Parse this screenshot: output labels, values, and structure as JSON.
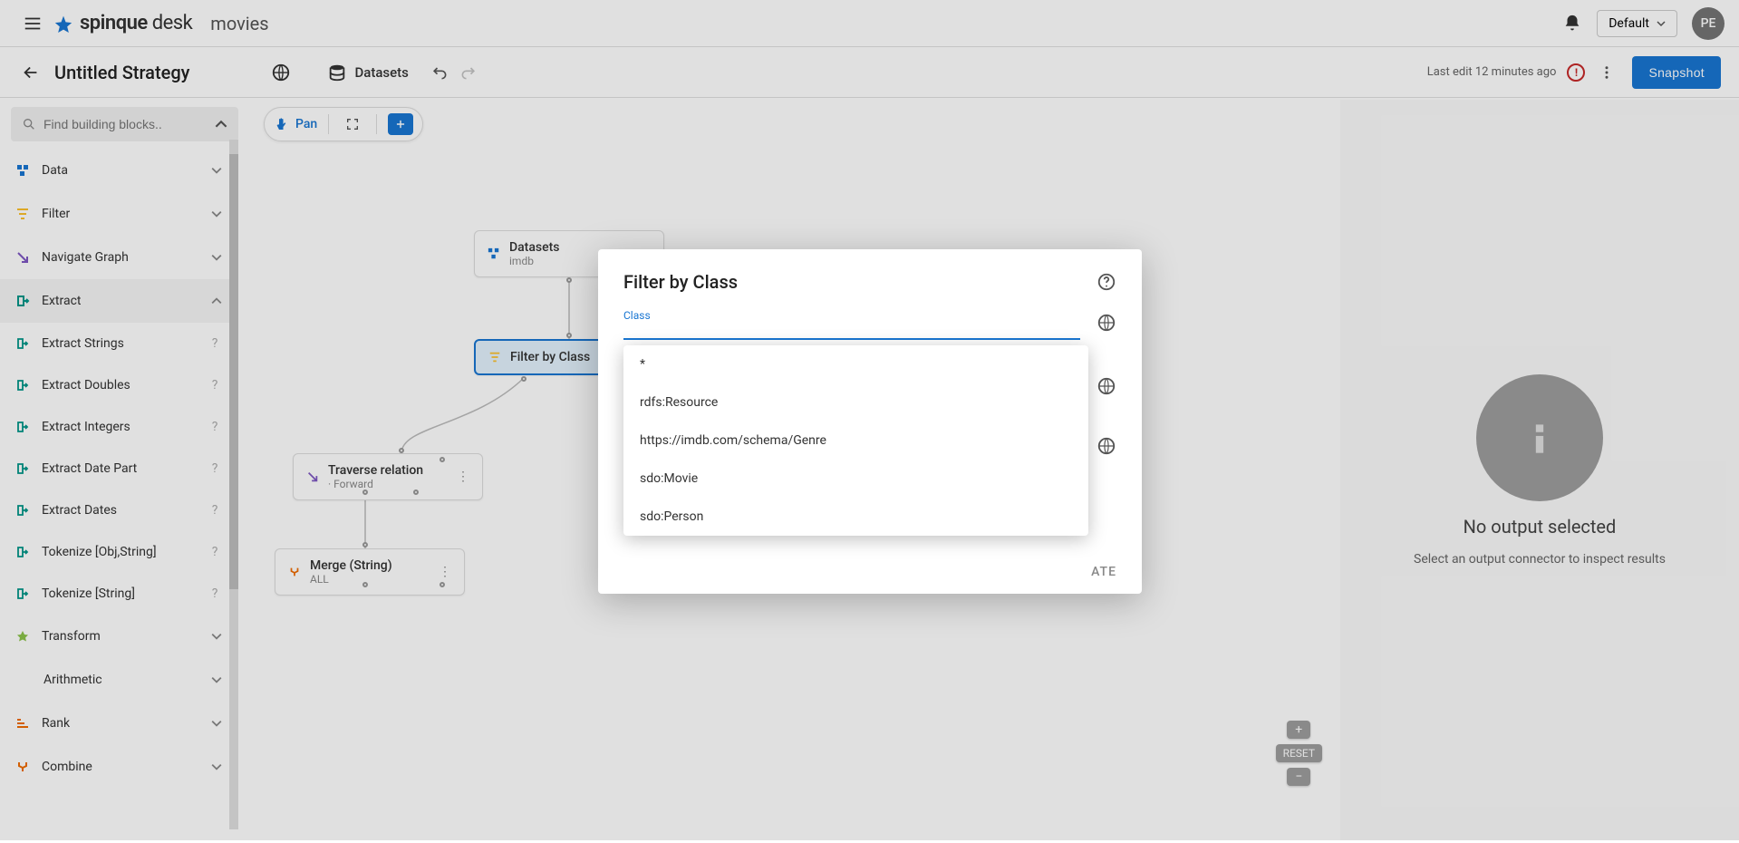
{
  "app": {
    "brand_primary": "spinque",
    "brand_secondary": "desk",
    "context": "movies"
  },
  "topbar": {
    "default_label": "Default",
    "avatar_initials": "PE"
  },
  "subbar": {
    "title": "Untitled Strategy",
    "datasets_label": "Datasets",
    "last_edit": "Last edit 12 minutes ago",
    "snapshot_label": "Snapshot"
  },
  "sidebar": {
    "search_placeholder": "Find building blocks..",
    "pan_label": "Pan",
    "categories": [
      {
        "label": "Data",
        "icon": "data",
        "expanded": false
      },
      {
        "label": "Filter",
        "icon": "filter",
        "expanded": false
      },
      {
        "label": "Navigate Graph",
        "icon": "navigate",
        "expanded": false
      },
      {
        "label": "Extract",
        "icon": "extract",
        "expanded": true,
        "items": [
          {
            "label": "Extract Strings"
          },
          {
            "label": "Extract Doubles"
          },
          {
            "label": "Extract Integers"
          },
          {
            "label": "Extract Date Part"
          },
          {
            "label": "Extract Dates"
          },
          {
            "label": "Tokenize [Obj,String]"
          },
          {
            "label": "Tokenize [String]"
          }
        ]
      },
      {
        "label": "Transform",
        "icon": "transform",
        "expanded": false
      },
      {
        "label": "Arithmetic",
        "icon": "none",
        "expanded": false,
        "indent": true
      },
      {
        "label": "Rank",
        "icon": "rank",
        "expanded": false
      },
      {
        "label": "Combine",
        "icon": "combine",
        "expanded": false
      }
    ]
  },
  "canvas": {
    "nodes": {
      "datasets": {
        "title": "Datasets",
        "sub": "imdb"
      },
      "filter_class": {
        "title": "Filter by Class"
      },
      "traverse": {
        "title": "Traverse relation",
        "sub": "· Forward"
      },
      "merge": {
        "title": "Merge (String)",
        "sub": "ALL"
      }
    },
    "reset_label": "RESET"
  },
  "right_panel": {
    "title": "No output selected",
    "hint": "Select an output connector to inspect results"
  },
  "dialog": {
    "title": "Filter by Class",
    "field_label": "Class",
    "options": [
      "*",
      "rdfs:Resource",
      "https://imdb.com/schema/Genre",
      "sdo:Movie",
      "sdo:Person"
    ],
    "action_label": "ATE"
  }
}
